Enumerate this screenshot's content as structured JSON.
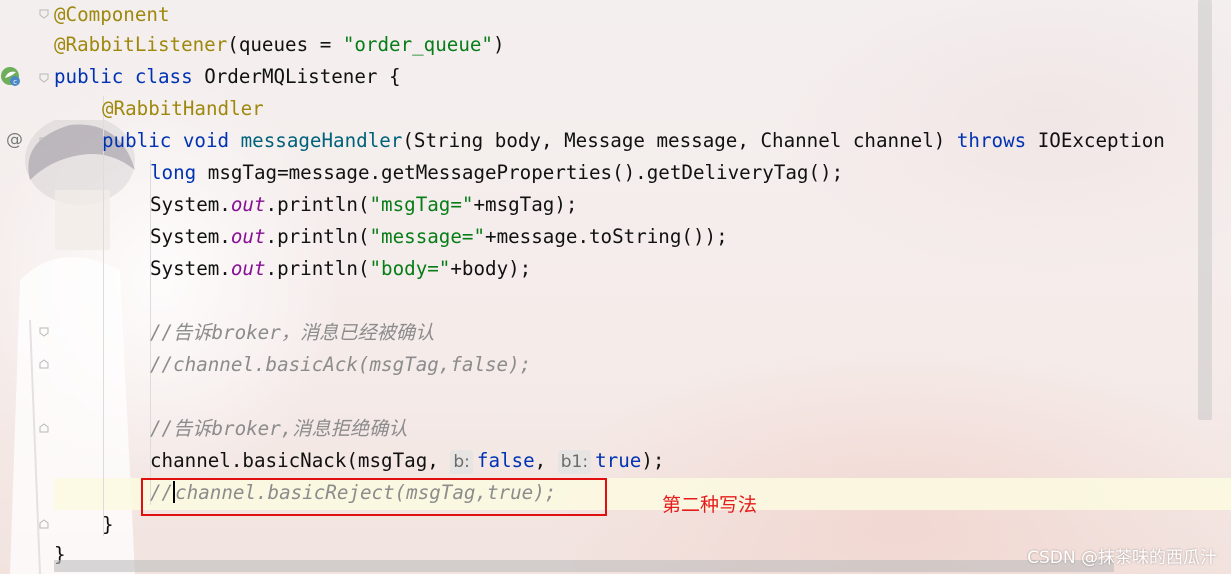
{
  "code": {
    "l1_annotation": "@Component",
    "l2_annotation": "@RabbitListener",
    "l2_open": "(queues = ",
    "l2_string": "\"order_queue\"",
    "l2_close": ")",
    "l3_kw": "public class ",
    "l3_rest": "OrderMQListener {",
    "l4_annotation": "@RabbitHandler",
    "l5_kw": "public void ",
    "l5_method": "messageHandler",
    "l5_params": "(String body, Message message, Channel channel) ",
    "l5_throws": "throws",
    "l5_exc": " IOException",
    "l6_kw": "long ",
    "l6_rest": "msgTag=message.getMessageProperties().getDeliveryTag();",
    "l7_a": "System.",
    "l7_field": "out",
    "l7_b": ".println(",
    "l7_str": "\"msgTag=\"",
    "l7_c": "+msgTag);",
    "l8_a": "System.",
    "l8_field": "out",
    "l8_b": ".println(",
    "l8_str": "\"message=\"",
    "l8_c": "+message.toString());",
    "l9_a": "System.",
    "l9_field": "out",
    "l9_b": ".println(",
    "l9_str": "\"body=\"",
    "l9_c": "+body);",
    "l11_comment": "//告诉broker，消息已经被确认",
    "l12_comment": "//channel.basicAck(msgTag,false);",
    "l14_comment": "//告诉broker,消息拒绝确认",
    "l15_a": "channel.basicNack(msgTag, ",
    "l15_hint1": "b:",
    "l15_v1": "false",
    "l15_comma": ", ",
    "l15_hint2": "b1:",
    "l15_v2": "true",
    "l15_end": ");",
    "l16_pre": "//",
    "l16_rest": "channel.basicReject(msgTag,true);",
    "l17": "}",
    "l18": "}"
  },
  "gutter": {
    "at_symbol": "@"
  },
  "annotation_label": "第二种写法",
  "watermark": "CSDN @抹茶味的西瓜汁",
  "colors": {
    "keyword": "#0033b3",
    "annotation": "#9e880d",
    "string": "#067d17",
    "field": "#871094",
    "comment": "#8c8c8c",
    "red": "#e01010"
  }
}
